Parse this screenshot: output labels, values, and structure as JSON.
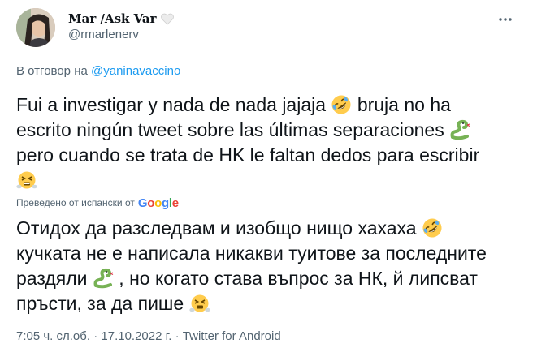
{
  "user": {
    "display_name": "Mar /Ask Var",
    "handle": "@rmarlenerv"
  },
  "reply": {
    "prefix": "В отговор на",
    "mention": "@yaninavaccino"
  },
  "tweet": {
    "original_parts": [
      "Fui a investigar y nada de nada jajaja",
      "bruja no ha escrito ningún tweet sobre las últimas separaciones",
      "pero cuando se trata de HK le faltan dedos para escribir"
    ],
    "translated_label": "Преведено от испански от",
    "translator_logo": "Google",
    "translation_parts": [
      "Отидох да разследвам и изобщо нищо хахаха",
      "кучката не е написала никакви туитове за последните раздяли",
      ", но когато става въпрос за НК, й липсват пръсти, за да пише"
    ]
  },
  "meta": {
    "time": "7:05 ч. сл.об.",
    "date": "17.10.2022 г.",
    "separator": "·",
    "source": "Twitter for Android"
  },
  "icons": {
    "heart": "white-heart-icon",
    "more": "more-options-icon",
    "laugh": "rolling-on-floor-laughing-emoji",
    "snake": "snake-emoji",
    "steam": "face-with-steam-emoji"
  },
  "colors": {
    "link": "#1d9bf0",
    "secondary_text": "#536471",
    "primary_text": "#0f1419"
  }
}
